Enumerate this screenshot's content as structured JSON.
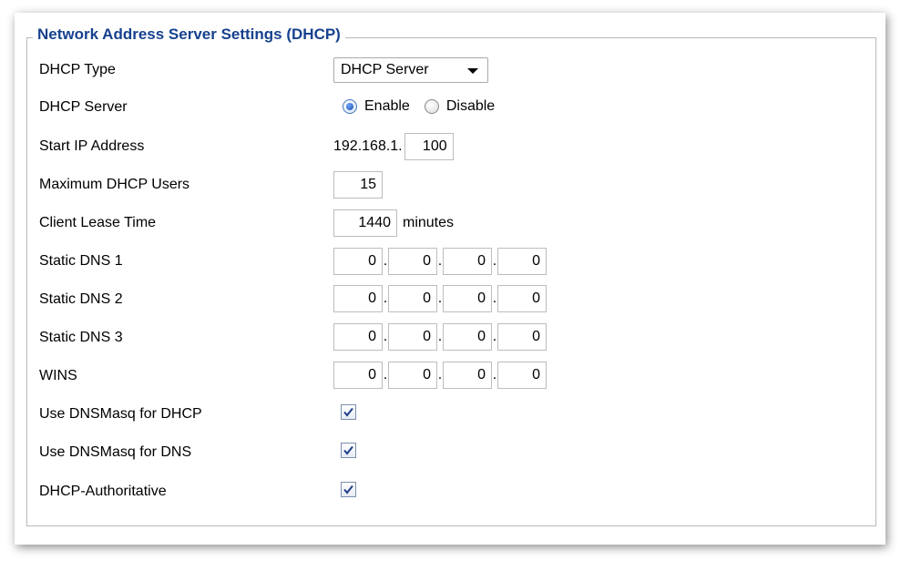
{
  "section": {
    "title": "Network Address Server Settings (DHCP)"
  },
  "fields": {
    "dhcp_type": {
      "label": "DHCP Type",
      "value": "DHCP Server"
    },
    "dhcp_server": {
      "label": "DHCP Server",
      "options": [
        "Enable",
        "Disable"
      ],
      "selected": "Enable"
    },
    "start_ip": {
      "label": "Start IP Address",
      "prefix": "192.168.1.",
      "value": "100"
    },
    "max_users": {
      "label": "Maximum DHCP Users",
      "value": "15"
    },
    "lease_time": {
      "label": "Client Lease Time",
      "value": "1440",
      "unit": "minutes"
    },
    "static_dns_1": {
      "label": "Static DNS 1",
      "octets": [
        "0",
        "0",
        "0",
        "0"
      ]
    },
    "static_dns_2": {
      "label": "Static DNS 2",
      "octets": [
        "0",
        "0",
        "0",
        "0"
      ]
    },
    "static_dns_3": {
      "label": "Static DNS 3",
      "octets": [
        "0",
        "0",
        "0",
        "0"
      ]
    },
    "wins": {
      "label": "WINS",
      "octets": [
        "0",
        "0",
        "0",
        "0"
      ]
    },
    "dnsmasq_dhcp": {
      "label": "Use DNSMasq for DHCP",
      "checked": true
    },
    "dnsmasq_dns": {
      "label": "Use DNSMasq for DNS",
      "checked": true
    },
    "dhcp_authoritative": {
      "label": "DHCP-Authoritative",
      "checked": true
    }
  },
  "separator": "."
}
